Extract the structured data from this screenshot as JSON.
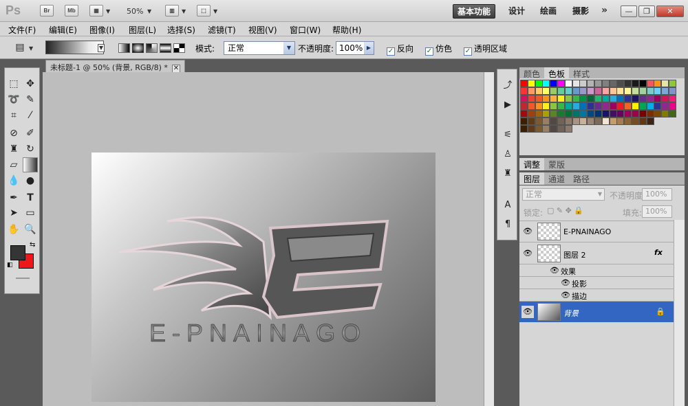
{
  "app": {
    "logo": "Ps",
    "bridge": "Br",
    "minibridge": "Mb",
    "zoom": "50%",
    "workspaces": [
      "基本功能",
      "设计",
      "绘画",
      "摄影"
    ],
    "more": "»",
    "win_min": "—",
    "win_restore": "❐",
    "win_close": "✕"
  },
  "menu": [
    "文件(F)",
    "编辑(E)",
    "图像(I)",
    "图层(L)",
    "选择(S)",
    "滤镜(T)",
    "视图(V)",
    "窗口(W)",
    "帮助(H)"
  ],
  "options": {
    "mode_label": "模式:",
    "mode_value": "正常",
    "opacity_label": "不透明度:",
    "opacity_value": "100%",
    "reverse": "反向",
    "dither": "仿色",
    "transparency": "透明区域"
  },
  "document": {
    "tab_title": "未标题-1 @ 50% (背景, RGB/8) *",
    "logo_text": "E-PNAINAGO"
  },
  "colors": {
    "foreground": "#353535",
    "background": "#ef1717"
  },
  "panels": {
    "top_tabs": [
      "颜色",
      "色板",
      "样式"
    ],
    "adjust_tabs": [
      "调整",
      "蒙版"
    ],
    "layer_tabs": [
      "图层",
      "通道",
      "路径"
    ],
    "blend_mode": "正常",
    "opacity_label": "不透明度:",
    "opacity_value": "100%",
    "lock_label": "锁定:",
    "fill_label": "填充:",
    "fill_value": "100%"
  },
  "layers": [
    {
      "name": "E-PNAINAGO"
    },
    {
      "name": "图层 2",
      "fx": "fx"
    },
    {
      "name": "效果"
    },
    {
      "name": "投影"
    },
    {
      "name": "描边"
    },
    {
      "name": "背景"
    }
  ]
}
